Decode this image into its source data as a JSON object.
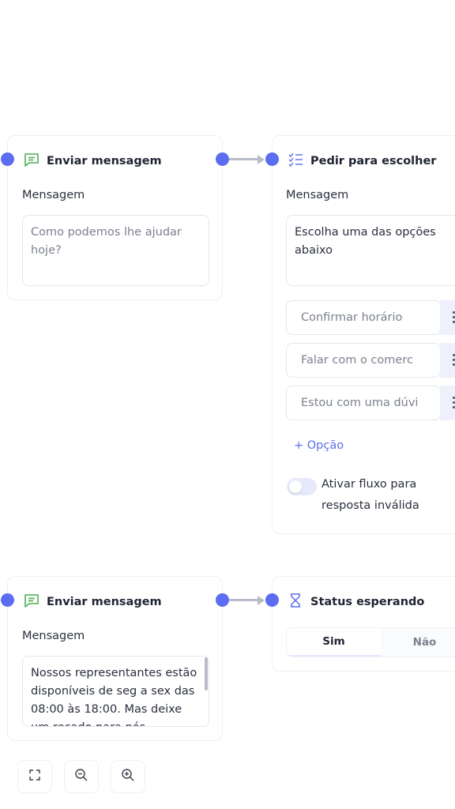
{
  "colors": {
    "accent": "#5b6df0",
    "connector": "#b8bcc8",
    "border": "#e3e6ec"
  },
  "nodes": {
    "send1": {
      "title": "Enviar mensagem",
      "icon": "message-square-icon",
      "message_label": "Mensagem",
      "message_placeholder": "Como podemos lhe ajudar hoje?"
    },
    "choose": {
      "title": "Pedir para escolher",
      "icon": "checklist-icon",
      "message_label": "Mensagem",
      "message_value": "Escolha uma das opções abaixo",
      "options": [
        "Confirmar horário",
        "Falar com o comerc",
        "Estou com uma dúvi"
      ],
      "add_option": "+ Opção",
      "toggle_label_line1": "Ativar fluxo para",
      "toggle_label_line2": "resposta inválida"
    },
    "send2": {
      "title": "Enviar mensagem",
      "icon": "message-square-icon",
      "message_label": "Mensagem",
      "message_value": "Nossos representantes estão disponíveis de seg a sex das 08:00 às 18:00. Mas deixe um recado para nós"
    },
    "status": {
      "title": "Status esperando",
      "icon": "hourglass-icon",
      "yes": "Sim",
      "no": "Não"
    }
  },
  "zoom_controls": [
    "fit-screen-icon",
    "zoom-out-icon",
    "zoom-in-icon"
  ]
}
